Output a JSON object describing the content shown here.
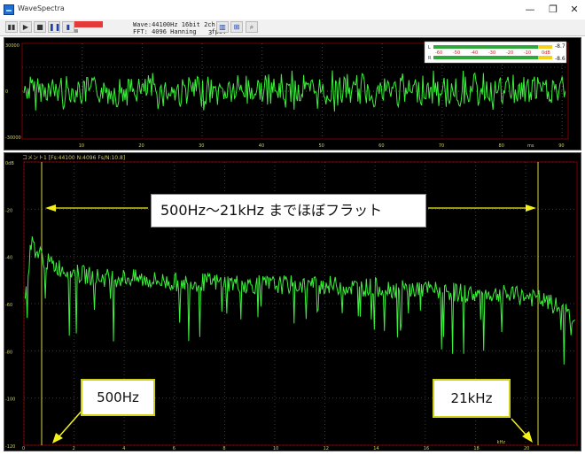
{
  "window": {
    "title": "WaveSpectra",
    "controls": [
      "—",
      "❐",
      "✕"
    ]
  },
  "toolbar": {
    "wave_line": "Wave:44100Hz 16bit 2ch",
    "fft_line": "FFT: 4096 Hanning    fps:",
    "fps_value": "3",
    "buttons": [
      "▮▮",
      "▶",
      "■",
      "❚❚",
      "▮"
    ]
  },
  "waveform": {
    "y_top": "30000",
    "y_mid": "0",
    "y_bottom": "-30000",
    "x_ticks": [
      "10",
      "20",
      "30",
      "40",
      "50",
      "60",
      "70",
      "80",
      "90"
    ],
    "x_unit": "ms",
    "level_meter": {
      "scale": [
        "-60",
        "-50",
        "-40",
        "-30",
        "-20",
        "-10",
        "0dB"
      ],
      "left_value": "-8.7",
      "right_value": "-8.6",
      "left_label": "L",
      "right_label": "R"
    }
  },
  "spectrum": {
    "header": "コメント1  [Fs:44100 N:4096 Fs/N:10.8]",
    "y_ticks": [
      "0dB",
      "-20",
      "-40",
      "-60",
      "-80",
      "-100",
      "-120"
    ],
    "x_ticks": [
      "0",
      "2",
      "4",
      "6",
      "8",
      "10",
      "12",
      "14",
      "16",
      "18",
      "20"
    ],
    "x_unit": "kHz"
  },
  "annotations": {
    "title": "500Hz～21kHz までほぼフラット",
    "left_label": "500Hz",
    "right_label": "21kHz"
  },
  "chart_data": [
    {
      "type": "line",
      "title": "",
      "xlabel": "ms",
      "ylabel": "",
      "xlim": [
        0,
        98
      ],
      "ylim": [
        -30000,
        30000
      ],
      "grid": true,
      "series": [
        {
          "values_description_free": true,
          "x": [
            0,
            10,
            20,
            30,
            40,
            50,
            60,
            70,
            80,
            90,
            98
          ],
          "y": [
            0,
            3500,
            -2500,
            3000,
            -3000,
            2000,
            -2000,
            2500,
            -2500,
            3000,
            0
          ]
        }
      ]
    },
    {
      "type": "line",
      "title": "",
      "xlabel": "kHz",
      "ylabel": "dB",
      "xlim": [
        0,
        22.05
      ],
      "ylim": [
        -120,
        0
      ],
      "grid": true,
      "series": [
        {
          "x": [
            0.1,
            0.3,
            0.5,
            1,
            2,
            3,
            4,
            5,
            6,
            7,
            8,
            9,
            10,
            11,
            12,
            13,
            14,
            15,
            16,
            17,
            18,
            19,
            20,
            20.5,
            21,
            21.5,
            22
          ],
          "y": [
            -55,
            -33,
            -38,
            -43,
            -47,
            -49,
            -49,
            -50,
            -51,
            -51,
            -51,
            -52,
            -52,
            -52,
            -52,
            -53,
            -53,
            -54,
            -54,
            -55,
            -56,
            -56,
            -57,
            -58,
            -60,
            -63,
            -66
          ]
        }
      ]
    }
  ]
}
